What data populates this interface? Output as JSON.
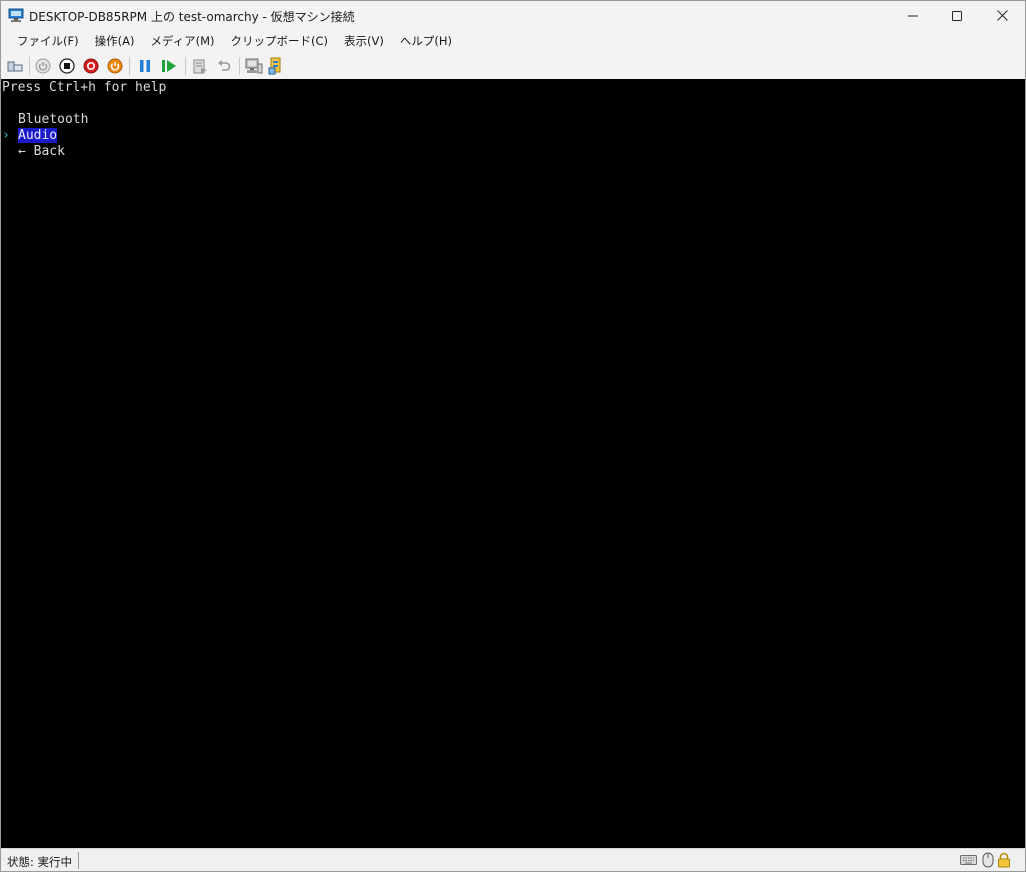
{
  "window": {
    "title": "DESKTOP-DB85RPM 上の test-omarchy  - 仮想マシン接続"
  },
  "menu": {
    "items": [
      {
        "label": "ファイル(F)"
      },
      {
        "label": "操作(A)"
      },
      {
        "label": "メディア(M)"
      },
      {
        "label": "クリップボード(C)"
      },
      {
        "label": "表示(V)"
      },
      {
        "label": "ヘルプ(H)"
      }
    ]
  },
  "toolbar": {
    "icons": [
      "ctrl-alt-del-icon",
      "start-icon",
      "turn-off-icon",
      "shut-down-icon",
      "save-state-icon",
      "pause-icon",
      "resume-icon",
      "checkpoint-icon",
      "revert-icon",
      "enhanced-session-icon",
      "share-icon"
    ]
  },
  "console": {
    "help_line": "Press Ctrl+h for help",
    "menu_items": [
      "Bluetooth",
      "Audio",
      "← Back"
    ],
    "selected_index": 1,
    "caret": "›"
  },
  "status": {
    "text": "状態: 実行中"
  },
  "colors": {
    "console_bg": "#000000",
    "console_text": "#d8d8d8",
    "selection": "#1b1bc9",
    "caret": "#3fb6c8"
  }
}
